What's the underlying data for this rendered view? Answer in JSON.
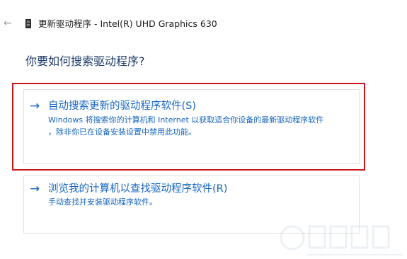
{
  "header": {
    "back_icon": "back-arrow-icon",
    "device_icon": "display-adapter-icon",
    "title": "更新驱动程序 - Intel(R) UHD Graphics 630"
  },
  "main": {
    "question": "你要如何搜索驱动程序?",
    "options": [
      {
        "arrow": "→",
        "title": "自动搜索更新的驱动程序软件(S)",
        "desc_line1": "Windows 将搜索你的计算机和 Internet 以获取适合你设备的最新驱动程序软件",
        "desc_line2": "，除非你已在设备安装设置中禁用此功能。",
        "highlighted": true
      },
      {
        "arrow": "→",
        "title": "浏览我的计算机以查找驱动程序软件(R)",
        "desc_line1": "手动查找并安装驱动程序软件。",
        "highlighted": false
      }
    ]
  },
  "colors": {
    "link_blue": "#1565c0",
    "heading_navy": "#1f3a6b",
    "highlight_red": "#c8181e",
    "card_border": "#e1e1e1"
  }
}
